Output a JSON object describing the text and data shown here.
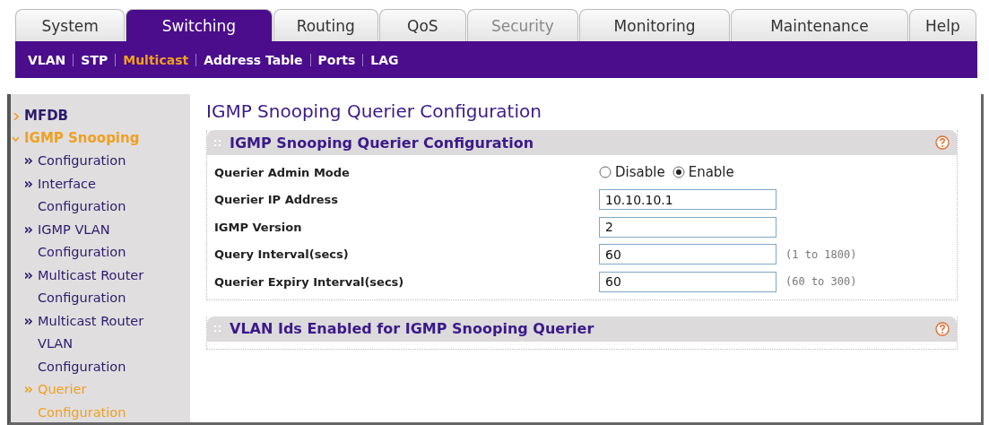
{
  "tabs": [
    {
      "label": "System",
      "selected": false,
      "disabled": false
    },
    {
      "label": "Switching",
      "selected": true,
      "disabled": false
    },
    {
      "label": "Routing",
      "selected": false,
      "disabled": false
    },
    {
      "label": "QoS",
      "selected": false,
      "disabled": false
    },
    {
      "label": "Security",
      "selected": false,
      "disabled": true
    },
    {
      "label": "Monitoring",
      "selected": false,
      "disabled": false
    },
    {
      "label": "Maintenance",
      "selected": false,
      "disabled": false
    },
    {
      "label": "Help",
      "selected": false,
      "disabled": false
    }
  ],
  "subnav": [
    {
      "label": "VLAN",
      "selected": false
    },
    {
      "label": "STP",
      "selected": false
    },
    {
      "label": "Multicast",
      "selected": true
    },
    {
      "label": "Address Table",
      "selected": false
    },
    {
      "label": "Ports",
      "selected": false
    },
    {
      "label": "LAG",
      "selected": false
    }
  ],
  "sidebar": {
    "items": [
      {
        "label": "MFDB",
        "selected": false,
        "expanded": false
      },
      {
        "label": "IGMP Snooping",
        "selected": true,
        "expanded": true,
        "children": [
          {
            "label": "Configuration",
            "selected": false
          },
          {
            "label": "Interface Configuration",
            "selected": false
          },
          {
            "label": "IGMP VLAN Configuration",
            "selected": false
          },
          {
            "label": "Multicast Router Configuration",
            "selected": false
          },
          {
            "label": "Multicast Router VLAN Configuration",
            "selected": false
          },
          {
            "label": "Querier Configuration",
            "selected": true
          }
        ]
      }
    ]
  },
  "page_title": "IGMP Snooping Querier Configuration",
  "panels": [
    {
      "title": "IGMP Snooping Querier Configuration",
      "fields": [
        {
          "kind": "radio",
          "label": "Querier Admin Mode",
          "options": [
            {
              "label": "Disable",
              "selected": false
            },
            {
              "label": "Enable",
              "selected": true
            }
          ]
        },
        {
          "kind": "text",
          "label": "Querier IP Address",
          "value": "10.10.10.1"
        },
        {
          "kind": "text",
          "label": "IGMP Version",
          "value": "2"
        },
        {
          "kind": "text",
          "label": "Query Interval(secs)",
          "value": "60",
          "hint": "(1 to 1800)"
        },
        {
          "kind": "text",
          "label": "Querier Expiry Interval(secs)",
          "value": "60",
          "hint": "(60 to 300)"
        }
      ]
    },
    {
      "title": "VLAN Ids Enabled for IGMP Snooping Querier"
    }
  ]
}
